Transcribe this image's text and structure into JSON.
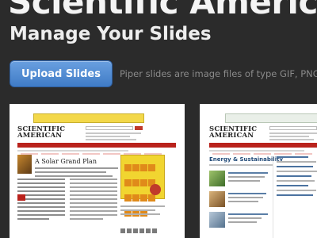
{
  "header": {
    "brand": "Scientific American",
    "title": "Manage Your Slides"
  },
  "toolbar": {
    "upload_label": "Upload Slides",
    "hint": "Piper slides are image files of  type GIF, PNG, o"
  },
  "slides": [
    {
      "logo": "SCIENTIFIC AMERICAN",
      "headline": "A Solar Grand Plan"
    },
    {
      "logo": "SCIENTIFIC AMERICAN",
      "headline": "Energy & Sustainability"
    }
  ],
  "colors": {
    "background": "#2b2b2b",
    "button": "#4f8bd4",
    "brand_red": "#b9221c"
  }
}
